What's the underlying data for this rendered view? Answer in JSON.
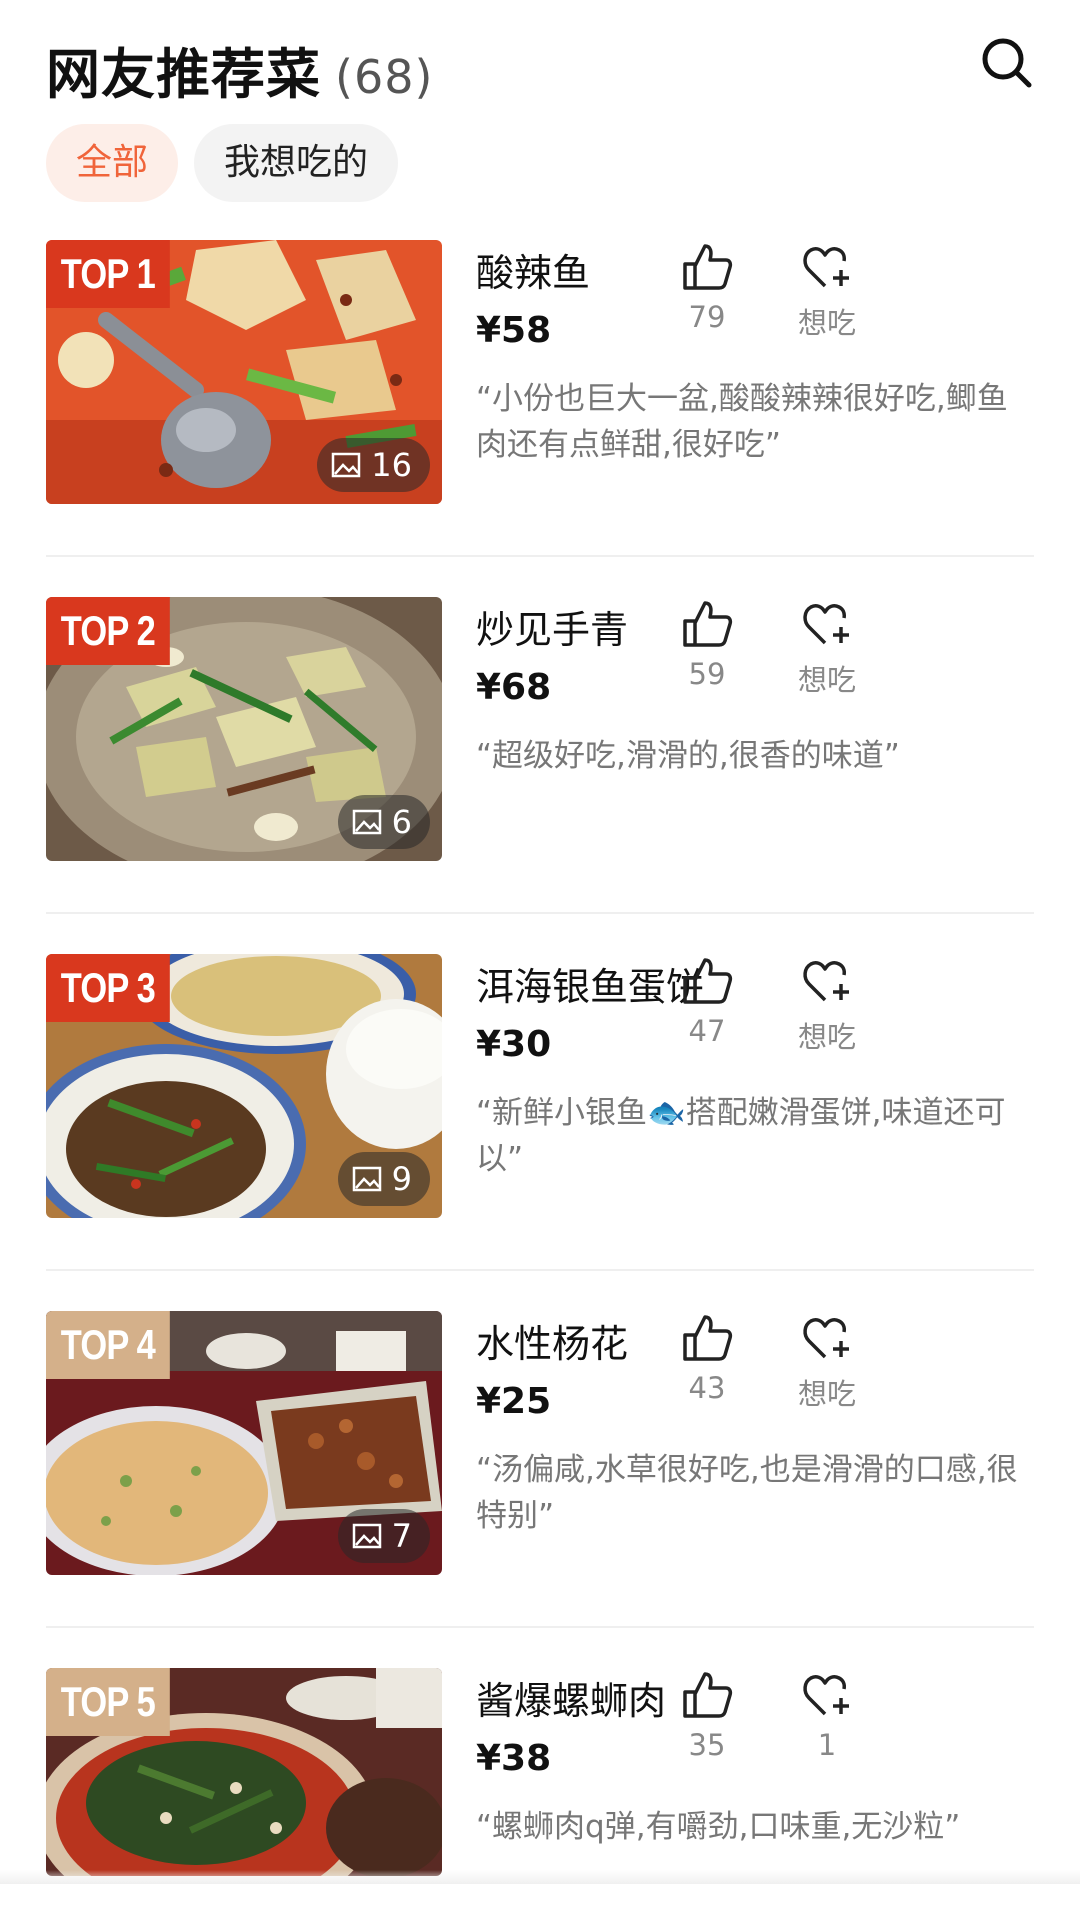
{
  "header": {
    "title": "网友推荐菜",
    "count": "(68)"
  },
  "filters": [
    {
      "label": "全部",
      "active": true
    },
    {
      "label": "我想吃的",
      "active": false
    }
  ],
  "colors": {
    "accent": "#f0643a",
    "rank_hot": "#d9381e",
    "rank_warm": "#d4b08a"
  },
  "dishes": [
    {
      "rank": "TOP 1",
      "rank_style": "hot",
      "name": "酸辣鱼",
      "price": "¥58",
      "quote": "“小份也巨大一盆,酸酸辣辣很好吃,鲫鱼肉还有点鲜甜,很好吃”",
      "photos": "16",
      "likes": "79",
      "want": "想吃"
    },
    {
      "rank": "TOP 2",
      "rank_style": "hot",
      "name": "炒见手青",
      "price": "¥68",
      "quote": "“超级好吃,滑滑的,很香的味道”",
      "photos": "6",
      "likes": "59",
      "want": "想吃"
    },
    {
      "rank": "TOP 3",
      "rank_style": "hot",
      "name": "洱海银鱼蛋饼",
      "price": "¥30",
      "quote": "“新鲜小银鱼🐟搭配嫩滑蛋饼,味道还可以”",
      "photos": "9",
      "likes": "47",
      "want": "想吃"
    },
    {
      "rank": "TOP 4",
      "rank_style": "warm",
      "name": "水性杨花",
      "price": "¥25",
      "quote": "“汤偏咸,水草很好吃,也是滑滑的口感,很特别”",
      "photos": "7",
      "likes": "43",
      "want": "想吃"
    },
    {
      "rank": "TOP 5",
      "rank_style": "warm",
      "name": "酱爆螺蛳肉",
      "price": "¥38",
      "quote": "“螺蛳肉q弹,有嚼劲,口味重,无沙粒”",
      "photos": "",
      "likes": "35",
      "want": "1"
    }
  ]
}
